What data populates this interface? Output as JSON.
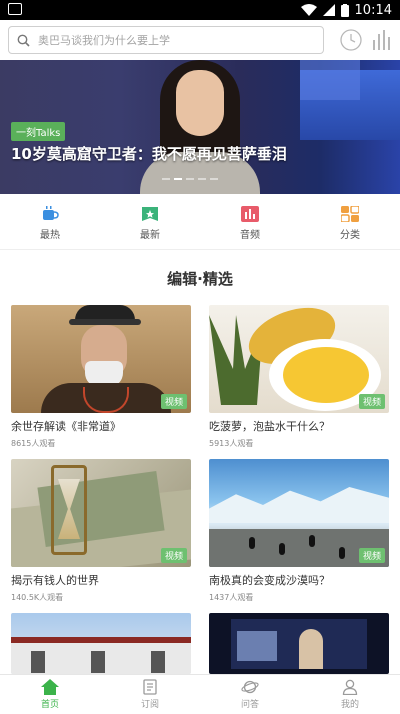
{
  "status_bar": {
    "time": "10:14"
  },
  "search": {
    "placeholder": "奥巴马谈我们为什么要上学"
  },
  "banner": {
    "tag": "一刻Talks",
    "title": "10岁莫高窟守卫者：我不愿再见菩萨垂泪"
  },
  "quick_nav": [
    {
      "label": "最热",
      "icon": "coffee-icon",
      "color": "#3b8fe0"
    },
    {
      "label": "最新",
      "icon": "new-star-icon",
      "color": "#3bb37a"
    },
    {
      "label": "音频",
      "icon": "audio-bars-icon",
      "color": "#e85b6a"
    },
    {
      "label": "分类",
      "icon": "category-grid-icon",
      "color": "#f0a040"
    }
  ],
  "section": {
    "title": "编辑·精选"
  },
  "cards": [
    {
      "title": "余世存解读《非常道》",
      "views": "8615人观看",
      "badge": "视频"
    },
    {
      "title": "吃菠萝，泡盐水干什么？",
      "views": "5913人观看",
      "badge": "视频"
    },
    {
      "title": "揭示有钱人的世界",
      "views": "140.5K人观看",
      "badge": "视频"
    },
    {
      "title": "南极真的会变成沙漠吗？",
      "views": "1437人观看",
      "badge": "视频"
    }
  ],
  "tabbar": [
    {
      "label": "首页",
      "icon": "home-icon",
      "active": true
    },
    {
      "label": "订阅",
      "icon": "subscribe-icon",
      "active": false
    },
    {
      "label": "问答",
      "icon": "planet-icon",
      "active": false
    },
    {
      "label": "我的",
      "icon": "person-icon",
      "active": false
    }
  ],
  "colors": {
    "accent": "#3bb34a",
    "badge": "#6ec070"
  }
}
